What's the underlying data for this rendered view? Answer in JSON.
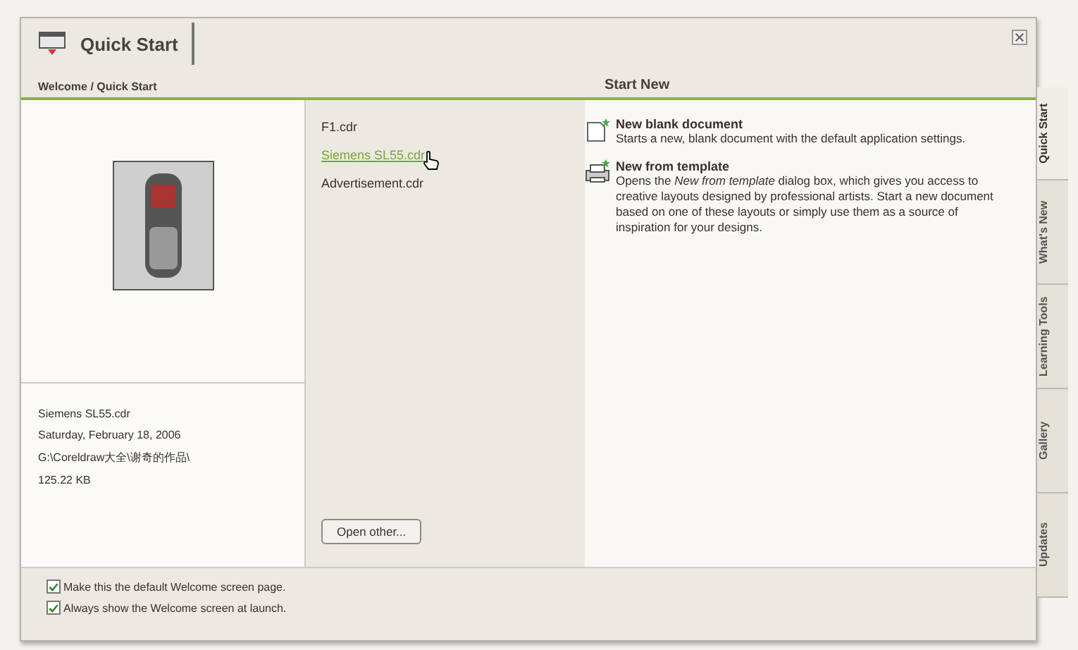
{
  "window": {
    "title": "Quick Start",
    "breadcrumb": "Welcome / Quick Start"
  },
  "preview": {
    "file_name": "Siemens SL55.cdr",
    "date": "Saturday, February 18, 2006",
    "path": "G:\\Coreldraw大全\\谢奇的作品\\",
    "size": "125.22 KB"
  },
  "recent_files": [
    {
      "name": "F1.cdr",
      "hovered": false
    },
    {
      "name": "Siemens SL55.cdr",
      "hovered": true
    },
    {
      "name": "Advertisement.cdr",
      "hovered": false
    }
  ],
  "open_button": "Open other...",
  "start_new": {
    "heading": "Start New",
    "items": [
      {
        "kind": "blank",
        "title": "New blank document",
        "description": "Starts a new, blank document with the default application settings."
      },
      {
        "kind": "template",
        "title": "New from template",
        "description": "Opens the *New from template* dialog box, which gives you access to creative layouts designed by professional artists. Start a new document based on one of these layouts or simply use them as a source of inspiration for your designs."
      }
    ]
  },
  "options": [
    {
      "label": "Make this the default Welcome screen page.",
      "checked": true
    },
    {
      "label": "Always show the Welcome screen at launch.",
      "checked": true
    }
  ],
  "side_tabs": [
    {
      "label": "Quick Start",
      "selected": true
    },
    {
      "label": "What's New",
      "selected": false
    },
    {
      "label": "Learning Tools",
      "selected": false
    },
    {
      "label": "Gallery",
      "selected": false
    },
    {
      "label": "Updates",
      "selected": false
    }
  ]
}
